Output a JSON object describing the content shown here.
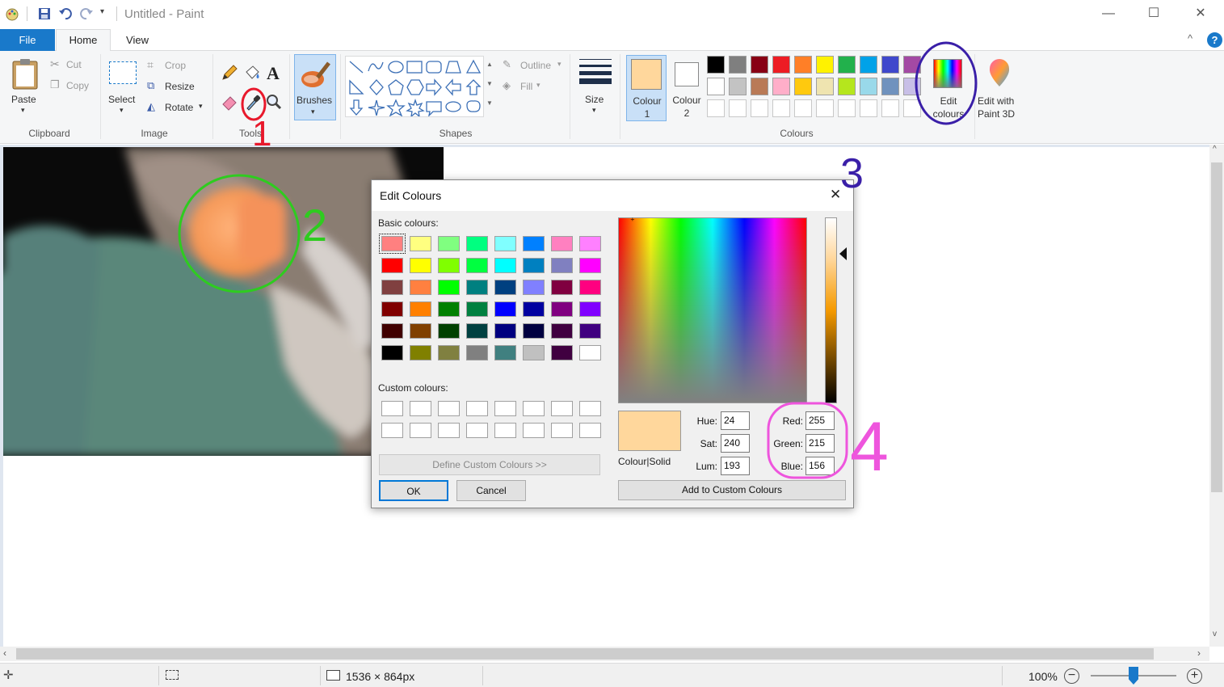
{
  "window": {
    "title": "Untitled - Paint",
    "minimize": "—",
    "maximize": "☐",
    "close": "✕"
  },
  "tabs": {
    "file": "File",
    "home": "Home",
    "view": "View"
  },
  "ribbon": {
    "clipboard": {
      "paste": "Paste",
      "cut": "Cut",
      "copy": "Copy",
      "group": "Clipboard"
    },
    "image": {
      "select": "Select",
      "crop": "Crop",
      "resize": "Resize",
      "rotate": "Rotate",
      "group": "Image"
    },
    "tools": {
      "group": "Tools"
    },
    "brushes": {
      "label": "Brushes"
    },
    "shapes": {
      "outline": "Outline",
      "fill": "Fill",
      "group": "Shapes"
    },
    "size": {
      "label": "Size"
    },
    "colours": {
      "colour1": "Colour\n1",
      "colour2": "Colour\n2",
      "colour1_value": "#ffd79c",
      "colour2_value": "#ffffff",
      "edit_colours": "Edit\ncolours",
      "edit_paint3d": "Edit with\nPaint 3D",
      "group": "Colours",
      "palette_row1": [
        "#000000",
        "#7f7f7f",
        "#880015",
        "#ed1c24",
        "#ff7f27",
        "#fff200",
        "#22b14c",
        "#00a2e8",
        "#3f48cc",
        "#a349a4"
      ],
      "palette_row2": [
        "#ffffff",
        "#c3c3c3",
        "#b97a57",
        "#ffaec9",
        "#ffc90e",
        "#efe4b0",
        "#b5e61d",
        "#99d9ea",
        "#7092be",
        "#c8bfe7"
      ]
    }
  },
  "status": {
    "dimensions": "1536 × 864px",
    "zoom": "100%"
  },
  "dialog": {
    "title": "Edit Colours",
    "basic_label": "Basic colours:",
    "custom_label": "Custom colours:",
    "define_button": "Define Custom Colours >>",
    "ok": "OK",
    "cancel": "Cancel",
    "colour_solid": "Colour|Solid",
    "add_custom": "Add to Custom Colours",
    "hue_label": "Hue:",
    "hue": "24",
    "sat_label": "Sat:",
    "sat": "240",
    "lum_label": "Lum:",
    "lum": "193",
    "red_label": "Red:",
    "red": "255",
    "green_label": "Green:",
    "green": "215",
    "blue_label": "Blue:",
    "blue": "156",
    "preview_colour": "#ffd79c",
    "basic_colours": [
      [
        "#ff8080",
        "#ffff80",
        "#80ff80",
        "#00ff80",
        "#80ffff",
        "#0080ff",
        "#ff80c0",
        "#ff80ff"
      ],
      [
        "#ff0000",
        "#ffff00",
        "#80ff00",
        "#00ff40",
        "#00ffff",
        "#0080c0",
        "#8080c0",
        "#ff00ff"
      ],
      [
        "#804040",
        "#ff8040",
        "#00ff00",
        "#008080",
        "#004080",
        "#8080ff",
        "#800040",
        "#ff0080"
      ],
      [
        "#800000",
        "#ff8000",
        "#008000",
        "#008040",
        "#0000ff",
        "#0000a0",
        "#800080",
        "#8000ff"
      ],
      [
        "#400000",
        "#804000",
        "#004000",
        "#004040",
        "#000080",
        "#000040",
        "#400040",
        "#400080"
      ],
      [
        "#000000",
        "#808000",
        "#808040",
        "#808080",
        "#408080",
        "#c0c0c0",
        "#400040",
        "#ffffff"
      ]
    ]
  },
  "annotations": {
    "n1": "1",
    "n2": "2",
    "n3": "3",
    "n4": "4"
  }
}
